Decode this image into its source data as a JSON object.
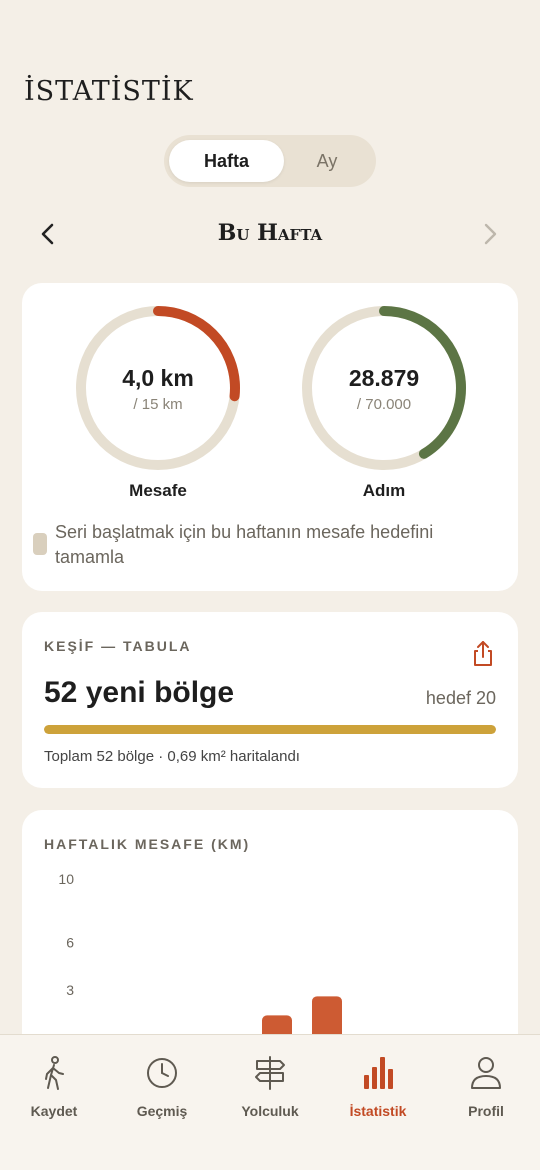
{
  "header": {
    "title": "İSTATİSTİK"
  },
  "segment": {
    "options": [
      "Hafta",
      "Ay"
    ],
    "selected": "Hafta"
  },
  "week_nav": {
    "label": "Bu Hafta"
  },
  "summary": {
    "distance": {
      "value": "4,0 km",
      "goal": "/ 15 km",
      "label": "Mesafe",
      "progress": 0.267,
      "color": "#c24a24"
    },
    "steps": {
      "value": "28.879",
      "goal": "/ 70.000",
      "label": "Adım",
      "progress": 0.413,
      "color": "#5c7545"
    },
    "ring_track_color": "#e6dfd1",
    "hint": "Seri başlatmak için bu haftanın mesafe hedefini tamamla"
  },
  "discovery": {
    "title": "KEŞİF — TABULA",
    "count_label": "52 yeni bölge",
    "goal_label": "hedef 20",
    "progress": 1.0,
    "bar_color": "#cda23a",
    "summary": "Toplam 52 bölge · 0,69 km² haritalandı"
  },
  "weekly": {
    "title": "HAFTALIK MESAFE (KM)"
  },
  "chart_data": {
    "type": "bar",
    "ylim": [
      0,
      10
    ],
    "y_ticks": [
      "10",
      "6",
      "3"
    ],
    "y_tick_values": [
      10,
      6,
      3
    ],
    "bars": [
      {
        "slot": 4,
        "value": 1.4
      },
      {
        "slot": 5,
        "value": 2.6
      }
    ],
    "bar_color": "#cd5b33"
  },
  "tabbar": {
    "items": [
      {
        "label": "Kaydet",
        "icon": "walk-icon"
      },
      {
        "label": "Geçmiş",
        "icon": "clock-icon"
      },
      {
        "label": "Yolculuk",
        "icon": "signpost-icon"
      },
      {
        "label": "İstatistik",
        "icon": "bar-chart-icon",
        "active": true
      },
      {
        "label": "Profil",
        "icon": "user-icon"
      }
    ],
    "active_color": "#c24a24"
  }
}
